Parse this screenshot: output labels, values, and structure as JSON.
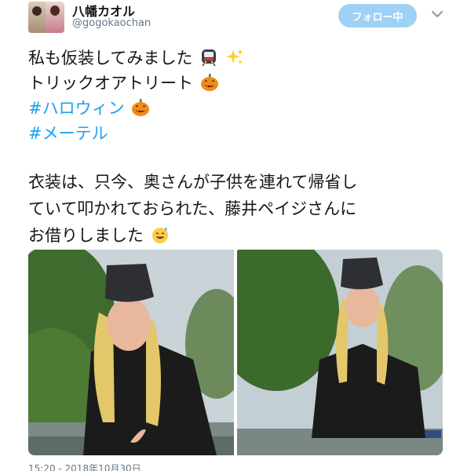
{
  "user": {
    "display_name": "八幡カオル",
    "handle": "@gogokaochan"
  },
  "follow_button": {
    "label": "フォロー中"
  },
  "tweet": {
    "lines": [
      "私も仮装してみました",
      "トリックオアトリート"
    ],
    "hashtags": [
      "#ハロウィン",
      "#メーテル"
    ],
    "body_lines": [
      "衣装は、只今、奥さんが子供を連れて帰省し",
      "ていて叩かれておられた、藤井ペイジさんに",
      "お借りしました"
    ]
  },
  "icons": {
    "train": "train-icon",
    "sparkles": "sparkles-icon",
    "pumpkin": "jack-o-lantern-icon",
    "sweat_smile": "sweat-smile-icon",
    "caret": "chevron-down-icon"
  },
  "colors": {
    "link": "#1da1f2",
    "follow_bg": "#9ed1f4",
    "muted": "#657786"
  },
  "media": {
    "photos": [
      {
        "alt": ""
      },
      {
        "alt": ""
      }
    ]
  },
  "timestamp": "15:20 - 2018年10月30日"
}
